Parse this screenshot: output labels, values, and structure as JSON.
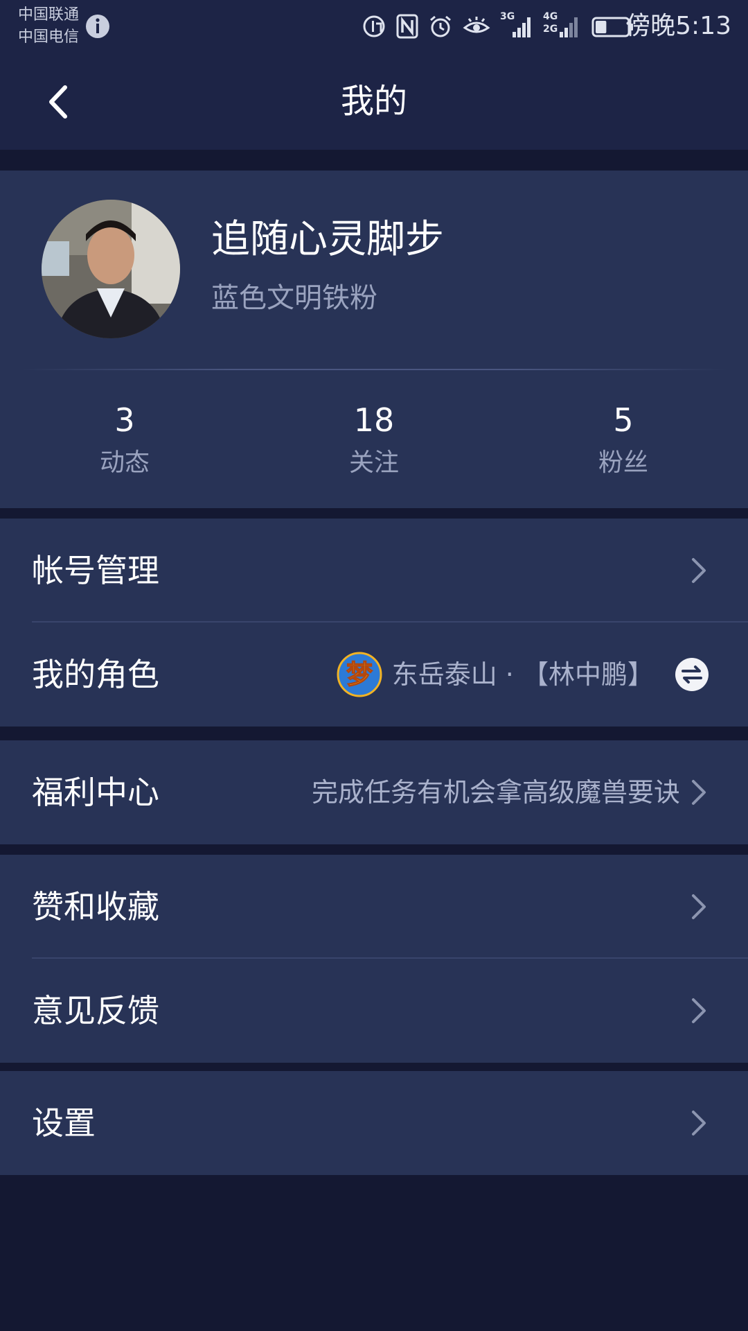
{
  "status_bar": {
    "carrier_1": "中国联通",
    "carrier_2": "中国电信",
    "time": "傍晚5:13",
    "network_1": "3G",
    "network_2a": "4G",
    "network_2b": "2G",
    "battery_level": 0.35,
    "icons": [
      "info-icon",
      "hd-call-icon",
      "nfc-icon",
      "alarm-icon",
      "eye-comfort-icon",
      "signal-icon",
      "signal-icon",
      "battery-icon"
    ]
  },
  "nav": {
    "title": "我的",
    "back_icon": "chevron-left-icon"
  },
  "profile": {
    "username": "追随心灵脚步",
    "tag": "蓝色文明铁粉",
    "stats": [
      {
        "value": "3",
        "label": "动态"
      },
      {
        "value": "18",
        "label": "关注"
      },
      {
        "value": "5",
        "label": "粉丝"
      }
    ]
  },
  "menu": {
    "account": {
      "label": "帐号管理"
    },
    "role": {
      "label": "我的角色",
      "logo_glyph": "梦",
      "server_name": "东岳泰山",
      "separator": "·",
      "character": "【林中鹏】",
      "switch_icon": "swap-icon"
    },
    "welfare": {
      "label": "福利中心",
      "hint": "完成任务有机会拿高级魔兽要诀"
    },
    "likes": {
      "label": "赞和收藏"
    },
    "feedback": {
      "label": "意见反馈"
    },
    "settings": {
      "label": "设置"
    }
  },
  "colors": {
    "page_bg": "#141832",
    "header_bg": "#1d2446",
    "card_bg": "#283356",
    "secondary_text": "#9aa3bf",
    "divider": "#39456c"
  }
}
